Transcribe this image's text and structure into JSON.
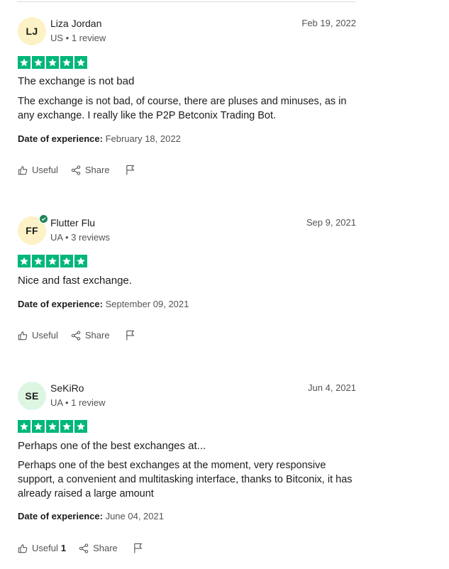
{
  "reviews": [
    {
      "initials": "LJ",
      "avatar_color": "#fdf2c5",
      "verified": false,
      "name": "Liza Jordan",
      "meta": "US • 1 review",
      "date": "Feb 19, 2022",
      "rating": 5,
      "title": "The exchange is not bad",
      "body": "The exchange is not bad, of course, there are pluses and minuses, as in any exchange. I really like the P2P Betconix Trading Bot.",
      "experience_label": "Date of experience:",
      "experience_date": "February 18, 2022",
      "useful_label": "Useful",
      "useful_count": "",
      "share_label": "Share"
    },
    {
      "initials": "FF",
      "avatar_color": "#fdf2c5",
      "verified": true,
      "name": "Flutter Flu",
      "meta": "UA • 3 reviews",
      "date": "Sep 9, 2021",
      "rating": 5,
      "title": "Nice and fast exchange.",
      "body": "",
      "experience_label": "Date of experience:",
      "experience_date": "September 09, 2021",
      "useful_label": "Useful",
      "useful_count": "",
      "share_label": "Share"
    },
    {
      "initials": "SE",
      "avatar_color": "#dcf6e2",
      "verified": false,
      "name": "SeKiRo",
      "meta": "UA • 1 review",
      "date": "Jun 4, 2021",
      "rating": 5,
      "title": "Perhaps one of the best exchanges at...",
      "body": "Perhaps one of the best exchanges at the moment, very responsive support, a convenient and multitasking interface, thanks to Bitconix, it has already raised a large amount",
      "experience_label": "Date of experience:",
      "experience_date": "June 04, 2021",
      "useful_label": "Useful",
      "useful_count": "1",
      "share_label": "Share"
    }
  ],
  "colors": {
    "star_green": "#00b67a",
    "verified_green": "#1a8558",
    "muted_text": "#545454"
  },
  "icons": {
    "star": "star-icon",
    "useful": "thumbs-up-icon",
    "share": "share-icon",
    "report": "flag-icon",
    "verified": "verified-check-icon"
  }
}
